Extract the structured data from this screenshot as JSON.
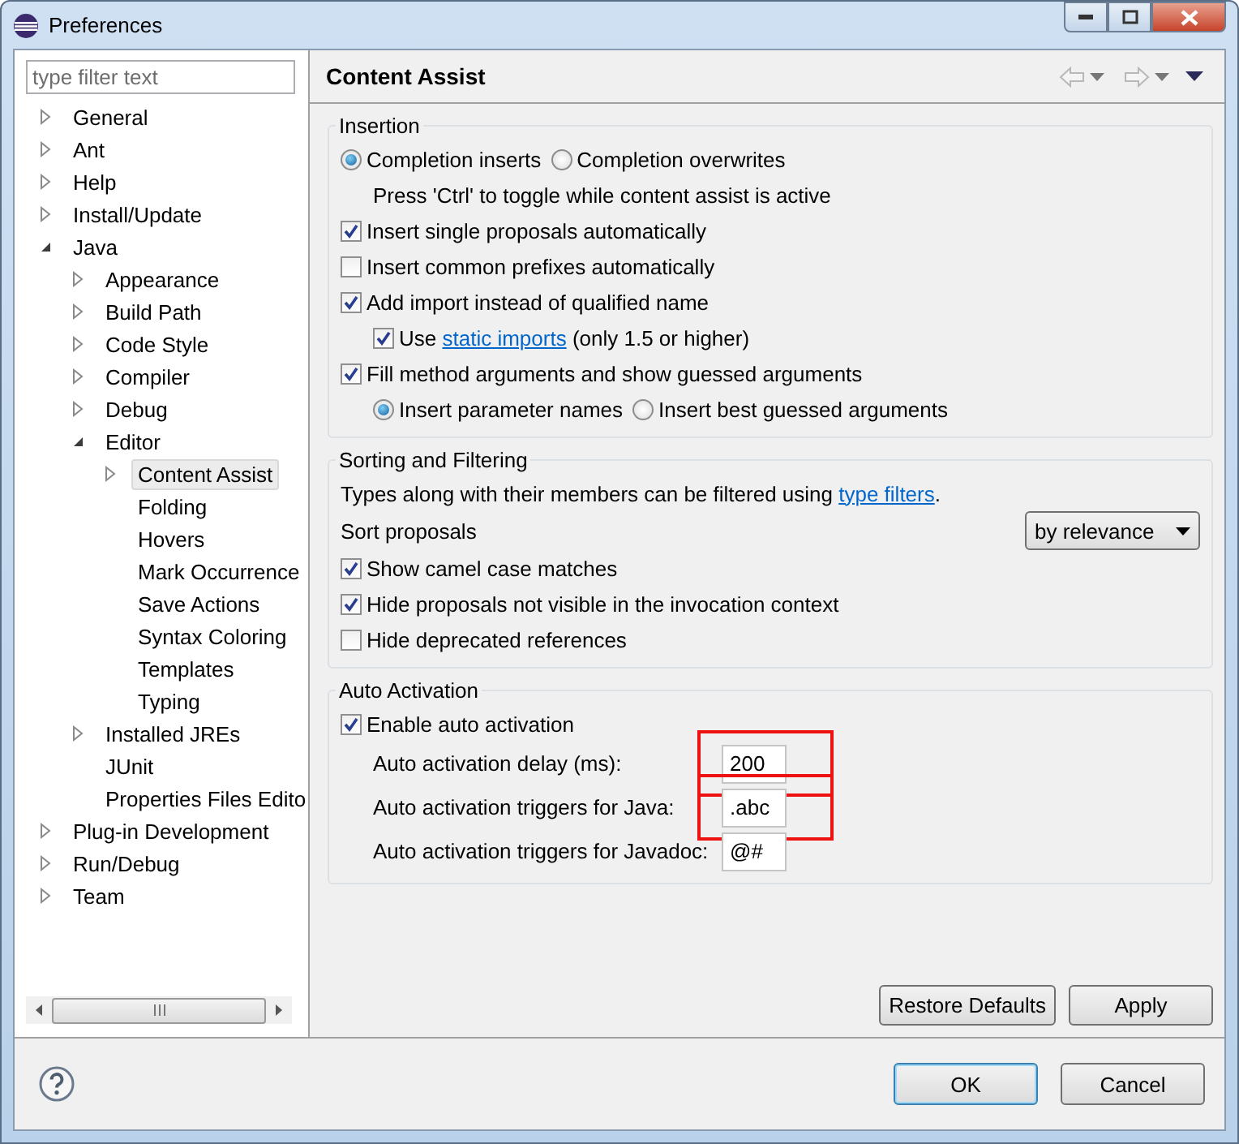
{
  "window": {
    "title": "Preferences"
  },
  "filter": {
    "placeholder": "type filter text"
  },
  "tree": [
    {
      "label": "General",
      "kind": "collapsed",
      "selected": false
    },
    {
      "label": "Ant",
      "kind": "collapsed",
      "selected": false
    },
    {
      "label": "Help",
      "kind": "collapsed",
      "selected": false
    },
    {
      "label": "Install/Update",
      "kind": "collapsed",
      "selected": false
    },
    {
      "label": "Java",
      "kind": "expanded",
      "selected": false,
      "children": [
        {
          "label": "Appearance",
          "kind": "collapsed",
          "selected": false
        },
        {
          "label": "Build Path",
          "kind": "collapsed",
          "selected": false
        },
        {
          "label": "Code Style",
          "kind": "collapsed",
          "selected": false
        },
        {
          "label": "Compiler",
          "kind": "collapsed",
          "selected": false
        },
        {
          "label": "Debug",
          "kind": "collapsed",
          "selected": false
        },
        {
          "label": "Editor",
          "kind": "expanded",
          "selected": false,
          "children": [
            {
              "label": "Content Assist",
              "kind": "collapsed",
              "selected": true
            },
            {
              "label": "Folding",
              "kind": "leaf",
              "selected": false
            },
            {
              "label": "Hovers",
              "kind": "leaf",
              "selected": false
            },
            {
              "label": "Mark Occurrence",
              "kind": "leaf",
              "selected": false
            },
            {
              "label": "Save Actions",
              "kind": "leaf",
              "selected": false
            },
            {
              "label": "Syntax Coloring",
              "kind": "leaf",
              "selected": false
            },
            {
              "label": "Templates",
              "kind": "leaf",
              "selected": false
            },
            {
              "label": "Typing",
              "kind": "leaf",
              "selected": false
            }
          ]
        },
        {
          "label": "Installed JREs",
          "kind": "collapsed",
          "selected": false
        },
        {
          "label": "JUnit",
          "kind": "leaf",
          "selected": false
        },
        {
          "label": "Properties Files Edito",
          "kind": "leaf",
          "selected": false
        }
      ]
    },
    {
      "label": "Plug-in Development",
      "kind": "collapsed",
      "selected": false
    },
    {
      "label": "Run/Debug",
      "kind": "collapsed",
      "selected": false
    },
    {
      "label": "Team",
      "kind": "collapsed",
      "selected": false
    }
  ],
  "page": {
    "title": "Content Assist"
  },
  "groups": [
    {
      "title": "Insertion",
      "rows": [
        {
          "kind": "radio-group",
          "options": [
            {
              "label": "Completion inserts",
              "selected": true
            },
            {
              "label": "Completion overwrites",
              "selected": false
            }
          ]
        },
        {
          "kind": "note",
          "text": "Press 'Ctrl' to toggle while content assist is active"
        },
        {
          "kind": "checkbox",
          "label": "Insert single proposals automatically",
          "checked": true
        },
        {
          "kind": "checkbox",
          "label": "Insert common prefixes automatically",
          "checked": false
        },
        {
          "kind": "checkbox",
          "label": "Add import instead of qualified name",
          "checked": true,
          "children": [
            {
              "kind": "checkbox",
              "label": "Use",
              "link": "static imports",
              "after": "(only 1.5 or higher)",
              "checked": true
            }
          ]
        },
        {
          "kind": "checkbox",
          "label": "Fill method arguments and show guessed arguments",
          "checked": true,
          "children": [
            {
              "kind": "radio-group",
              "options": [
                {
                  "label": "Insert parameter names",
                  "selected": true
                },
                {
                  "label": "Insert best guessed arguments",
                  "selected": false
                }
              ]
            }
          ]
        }
      ]
    },
    {
      "title": "Sorting and Filtering",
      "rows": [
        {
          "kind": "text",
          "text": "Types along with their members can be filtered using",
          "link": "type filters",
          "after": "."
        },
        {
          "kind": "select",
          "label": "Sort proposals",
          "value": "by relevance"
        },
        {
          "kind": "checkbox",
          "label": "Show camel case matches",
          "checked": true
        },
        {
          "kind": "checkbox",
          "label": "Hide proposals not visible in the invocation context",
          "checked": true
        },
        {
          "kind": "checkbox",
          "label": "Hide deprecated references",
          "checked": false
        }
      ]
    },
    {
      "title": "Auto Activation",
      "rows": [
        {
          "kind": "checkbox",
          "label": "Enable auto activation",
          "checked": true
        },
        {
          "kind": "field",
          "label": "Auto activation delay (ms):",
          "value": "200",
          "highlighted": true
        },
        {
          "kind": "field",
          "label": "Auto activation triggers for Java:",
          "value": ".abc",
          "highlighted": true
        },
        {
          "kind": "field",
          "label": "Auto activation triggers for Javadoc:",
          "value": "@#",
          "highlighted": false
        }
      ]
    }
  ],
  "page_buttons": [
    "Restore Defaults",
    "Apply"
  ],
  "dialog_buttons": [
    {
      "label": "OK",
      "default": true
    },
    {
      "label": "Cancel",
      "default": false
    }
  ]
}
